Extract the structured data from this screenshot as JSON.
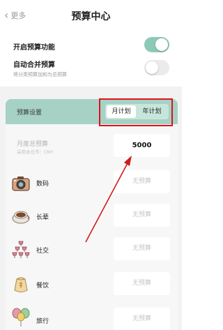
{
  "nav": {
    "back_label": "更多",
    "title": "预算中心"
  },
  "settings": {
    "enable_budget": {
      "label": "开启预算功能",
      "on": true
    },
    "auto_merge": {
      "label": "自动合并预算",
      "sub": "将分类预算加和为总预算",
      "on": false
    }
  },
  "budget_card": {
    "header_label": "预算设置",
    "tabs": [
      {
        "label": "月计划",
        "active": true
      },
      {
        "label": "年计划",
        "active": false
      }
    ],
    "total": {
      "label": "月度总预算",
      "sub": "采用本位币：CNY",
      "value": "5000"
    },
    "categories": [
      {
        "name": "数码",
        "icon": "camera-icon",
        "value": "无预算"
      },
      {
        "name": "长辈",
        "icon": "coffee-cup-icon",
        "value": "无预算"
      },
      {
        "name": "社交",
        "icon": "wine-glasses-icon",
        "value": "无预算"
      },
      {
        "name": "餐饮",
        "icon": "grain-sack-icon",
        "value": "无预算"
      },
      {
        "name": "旅行",
        "icon": "balloons-icon",
        "value": "无预算"
      }
    ]
  },
  "colors": {
    "accent": "#8ec9b8",
    "header": "#a5d2c4",
    "highlight": "#e0101e"
  }
}
